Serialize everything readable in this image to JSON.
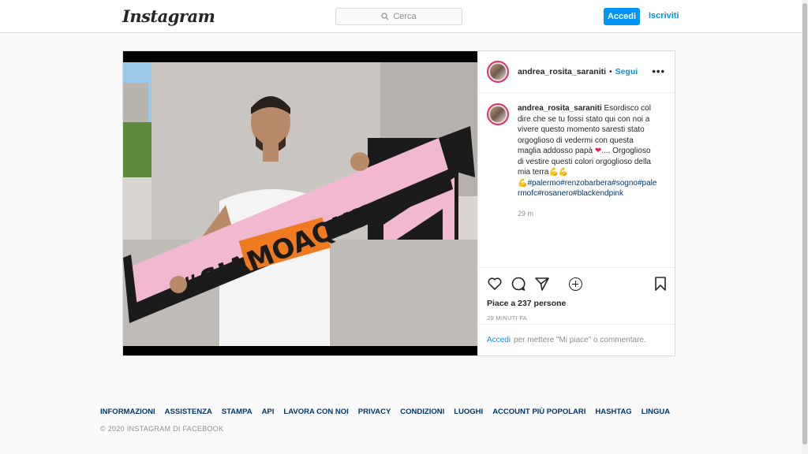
{
  "header": {
    "logo": "Instagram",
    "search_placeholder": "Cerca",
    "login_label": "Accedi",
    "signup_label": "Iscriviti"
  },
  "post": {
    "username": "andrea_rosita_saraniti",
    "follow_label": "Segui",
    "more_label": "•••",
    "caption": {
      "username": "andrea_rosita_saraniti",
      "text": "Esordisco col dire che se tu fossi stato qui con noi a vivere questo momento saresti stato orgoglioso di vedermi con questa maglia addosso papà",
      "heart": "❤",
      "text2": ".... Orgoglioso di vestire questi colori orgoglioso della mia terra",
      "muscles1": "💪💪",
      "muscles2": "💪",
      "hashtags": "#palermo#renzobarbera#sogno#palermofc#rosanero#blackendpink"
    },
    "comment_time": "29 m",
    "likes": "Piace a 237 persone",
    "posted_ago": "29 MINUTI FA",
    "login_prompt_link": "Accedi",
    "login_prompt_text": "per mettere \"Mi piace\" o commentare.",
    "photo": {
      "scarf_text": "#SIAMOAQUILE"
    }
  },
  "footer": {
    "links": [
      "INFORMAZIONI",
      "ASSISTENZA",
      "STAMPA",
      "API",
      "LAVORA CON NOI",
      "PRIVACY",
      "CONDIZIONI",
      "LUOGHI",
      "ACCOUNT PIÙ POPOLARI",
      "HASHTAG",
      "LINGUA"
    ],
    "copyright": "© 2020 INSTAGRAM DI FACEBOOK"
  },
  "colors": {
    "accent": "#0095f6",
    "hashtag": "#00376b",
    "border": "#dbdbdb",
    "scarf_pink": "#f2b8cf"
  }
}
